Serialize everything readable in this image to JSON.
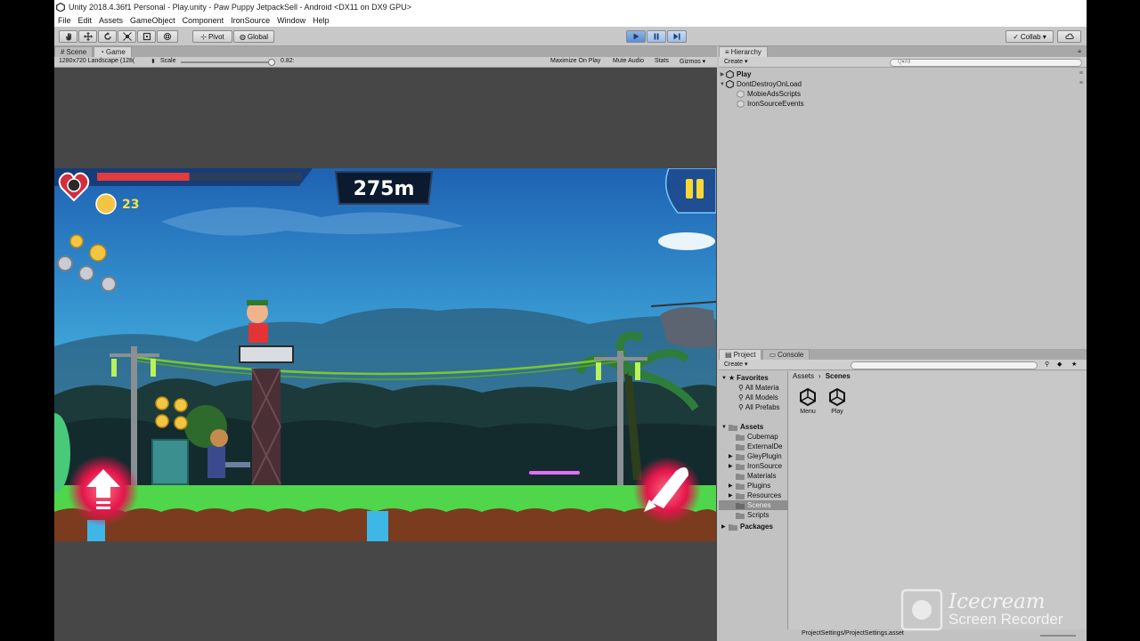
{
  "window": {
    "title": "Unity 2018.4.36f1 Personal - Play.unity - Paw Puppy JetpackSell - Android <DX11 on DX9 GPU>"
  },
  "menu": [
    "File",
    "Edit",
    "Assets",
    "GameObject",
    "Component",
    "IronSource",
    "Window",
    "Help"
  ],
  "toolbar": {
    "pivot_label": "Pivot",
    "global_label": "Global",
    "collab_label": "Collab ▾"
  },
  "game_panel": {
    "tabs": [
      {
        "label": "Scene",
        "icon": "grid-icon"
      },
      {
        "label": "Game",
        "icon": "pacman-icon"
      }
    ],
    "resolution": "1280x720 Landscape (128(",
    "scale_label": "Scale",
    "scale_value": "0.82:",
    "maximize_label": "Maximize On Play",
    "mute_label": "Mute Audio",
    "stats_label": "Stats",
    "gizmos_label": "Gizmos ▾",
    "hud": {
      "distance": "275m",
      "coins": "23",
      "health_fraction": 0.45
    }
  },
  "hierarchy": {
    "tab_label": "Hierarchy",
    "create_label": "Create ▾",
    "search_placeholder": "Q▾All",
    "items": [
      {
        "label": "Play",
        "bold": true,
        "expanded": false
      },
      {
        "label": "DontDestroyOnLoad",
        "bold": false,
        "expanded": true
      },
      {
        "label": "MobieAdsScripts",
        "bold": false
      },
      {
        "label": "IronSourceEvents",
        "bold": false
      }
    ]
  },
  "project": {
    "tabs": [
      "Project",
      "Console"
    ],
    "create_label": "Create ▾",
    "favorites_label": "Favorites",
    "favorites": [
      "All Materia",
      "All Models",
      "All Prefabs"
    ],
    "assets_label": "Assets",
    "folders": [
      "Cubemap",
      "ExternalDe",
      "GleyPlugin",
      "IronSource",
      "Materials",
      "Plugins",
      "Resources",
      "Scenes",
      "Scripts"
    ],
    "selected_folder": "Scenes",
    "packages_label": "Packages",
    "breadcrumb": [
      "Assets",
      "Scenes"
    ],
    "assets": [
      "Menu",
      "Play"
    ],
    "status_path": "ProjectSettings/ProjectSettings.asset"
  },
  "watermark": {
    "line1": "Icecream",
    "line2": "Screen Recorder"
  },
  "colors": {
    "editor_bg": "#c2c2c2",
    "game_bg": "#474747",
    "play_accent": "#5a8fd4",
    "grass": "#4fd64a",
    "hud_red": "#e23b3b"
  }
}
